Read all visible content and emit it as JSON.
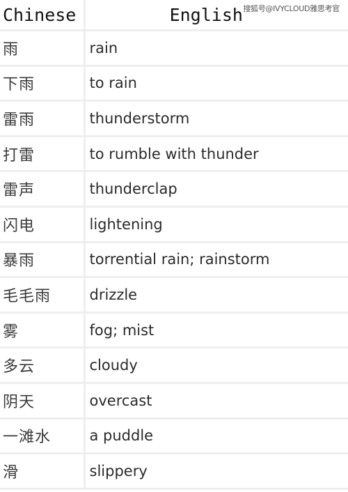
{
  "watermark": "搜狐号@IVYCLOUD雅思考官",
  "table": {
    "headers": {
      "chinese": "Chinese",
      "english": "English"
    },
    "rows": [
      {
        "chinese": "雨",
        "english": "rain"
      },
      {
        "chinese": "下雨",
        "english": "to rain"
      },
      {
        "chinese": "雷雨",
        "english": "thunderstorm"
      },
      {
        "chinese": "打雷",
        "english": "to rumble with thunder"
      },
      {
        "chinese": "雷声",
        "english": "thunderclap"
      },
      {
        "chinese": "闪电",
        "english": "lightening"
      },
      {
        "chinese": "暴雨",
        "english": "torrential rain; rainstorm"
      },
      {
        "chinese": "毛毛雨",
        "english": "drizzle"
      },
      {
        "chinese": "雾",
        "english": "fog; mist"
      },
      {
        "chinese": "多云",
        "english": "cloudy"
      },
      {
        "chinese": "阴天",
        "english": "overcast"
      },
      {
        "chinese": "一滩水",
        "english": "a puddle"
      },
      {
        "chinese": "滑",
        "english": "slippery"
      }
    ]
  }
}
